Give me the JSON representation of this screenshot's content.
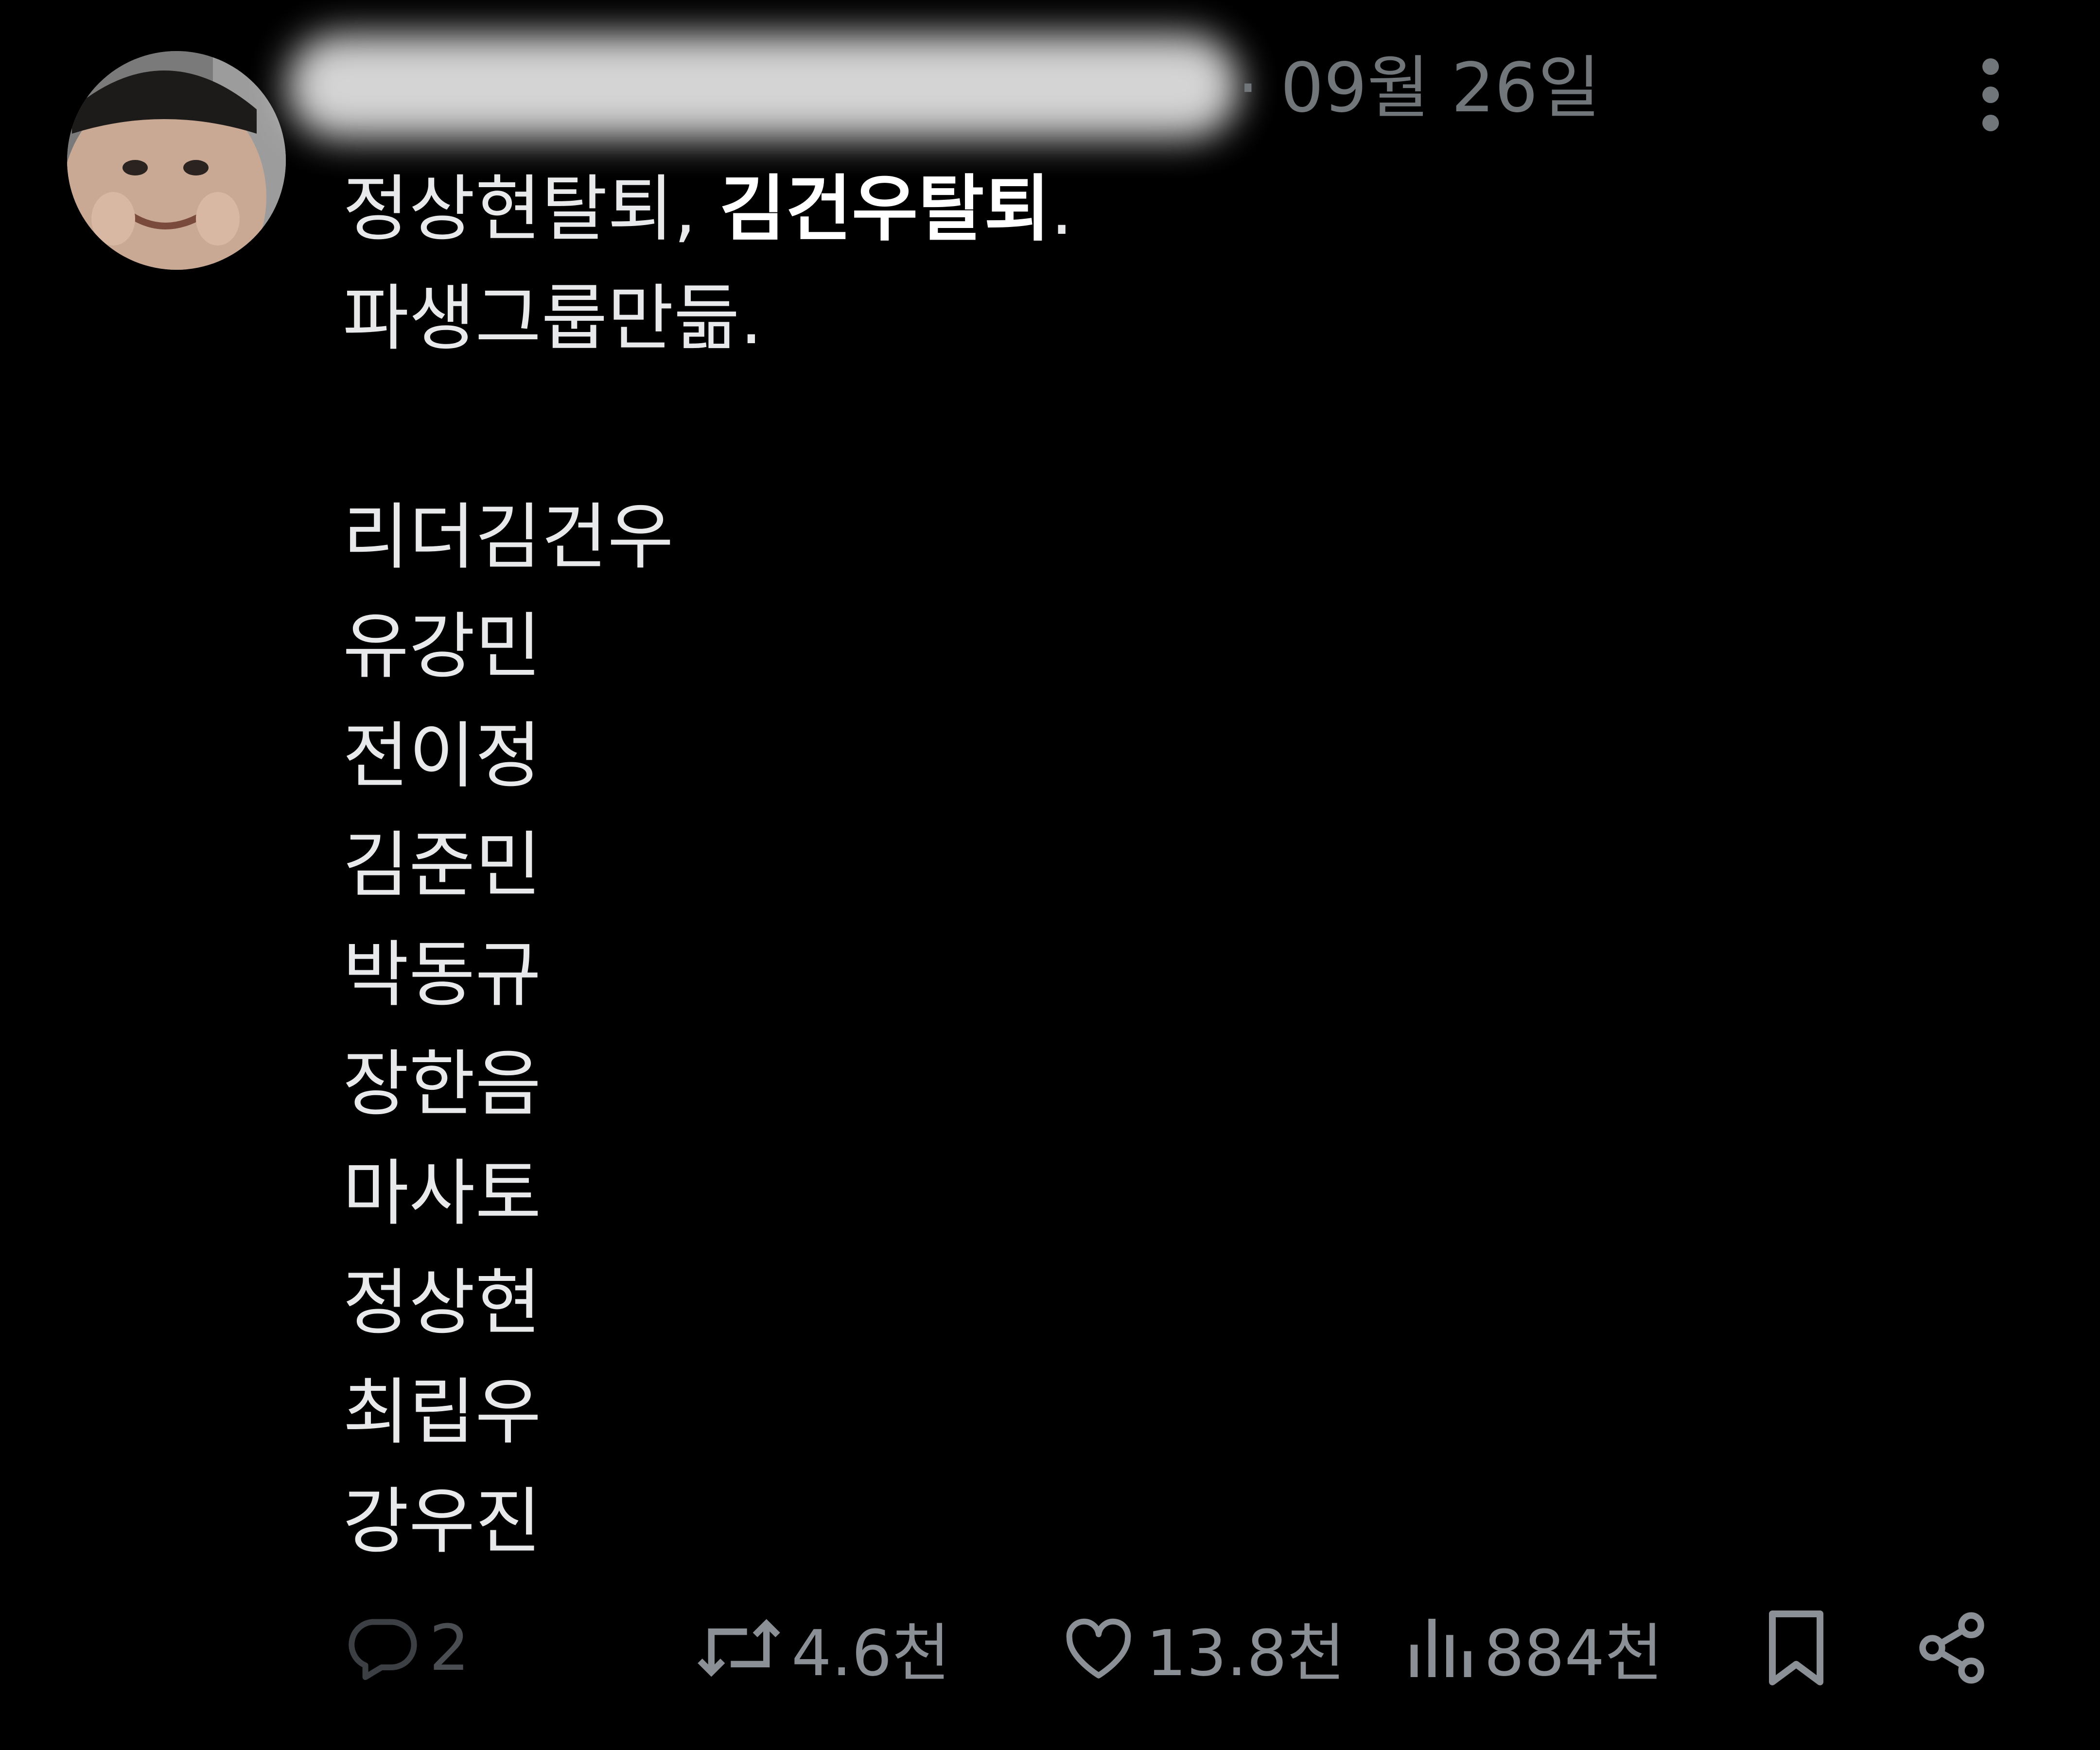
{
  "post": {
    "date": "· 09월 26일",
    "lines": [
      {
        "plain": "정상현탈퇴, ",
        "bold": "김건우탈퇴",
        "tail": "."
      },
      {
        "plain": "파생그룹만듦.",
        "bold": "",
        "tail": ""
      },
      {
        "plain": "",
        "bold": "",
        "tail": ""
      },
      {
        "plain": "리더김건우",
        "bold": "",
        "tail": ""
      },
      {
        "plain": "유강민",
        "bold": "",
        "tail": ""
      },
      {
        "plain": "전이정",
        "bold": "",
        "tail": ""
      },
      {
        "plain": "김준민",
        "bold": "",
        "tail": ""
      },
      {
        "plain": "박동규",
        "bold": "",
        "tail": ""
      },
      {
        "plain": "장한음",
        "bold": "",
        "tail": ""
      },
      {
        "plain": "마사토",
        "bold": "",
        "tail": ""
      },
      {
        "plain": "정상현",
        "bold": "",
        "tail": ""
      },
      {
        "plain": "최립우",
        "bold": "",
        "tail": ""
      },
      {
        "plain": "강우진",
        "bold": "",
        "tail": ""
      }
    ]
  },
  "actions": {
    "reply": {
      "icon": "reply-icon",
      "count": "2"
    },
    "repost": {
      "icon": "repost-icon",
      "count": "4.6천"
    },
    "like": {
      "icon": "heart-icon",
      "count": "13.8천"
    },
    "views": {
      "icon": "views-bar-icon",
      "count": "884천"
    },
    "bookmark": {
      "icon": "bookmark-icon"
    },
    "share": {
      "icon": "share-icon"
    }
  },
  "colors": {
    "background": "#000000",
    "text": "#e7e9ea",
    "muted": "#71767b"
  }
}
